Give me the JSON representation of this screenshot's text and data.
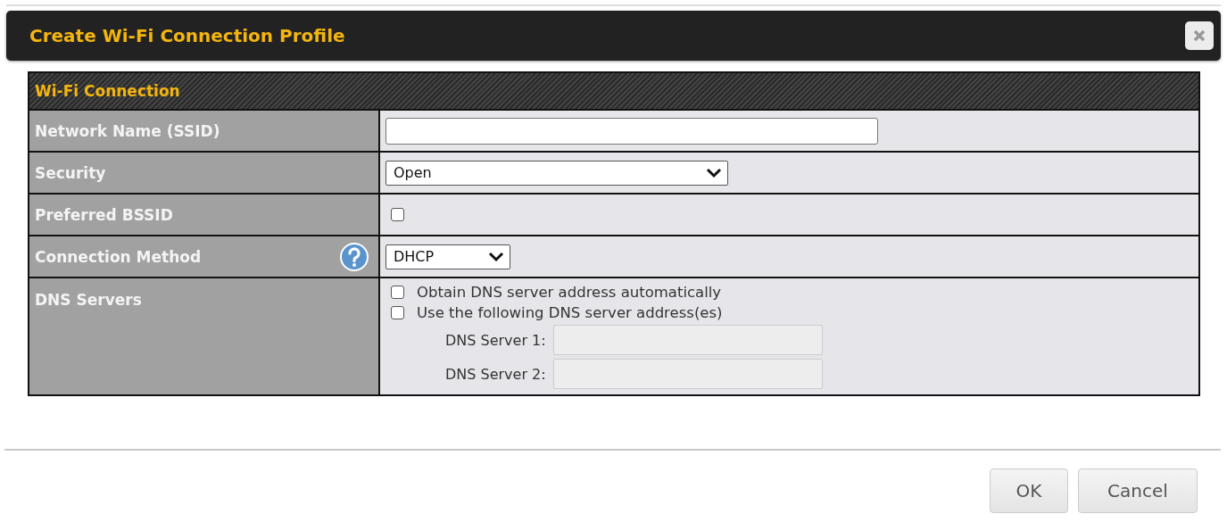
{
  "dialog": {
    "title": "Create Wi-Fi Connection Profile"
  },
  "section": {
    "title": "Wi-Fi Connection"
  },
  "rows": [
    {
      "kind": "text",
      "label": "Network Name (SSID)",
      "value": ""
    },
    {
      "kind": "select",
      "label": "Security",
      "value": "Open",
      "wide": true
    },
    {
      "kind": "checkbox",
      "label": "Preferred BSSID",
      "checked": false
    },
    {
      "kind": "select",
      "label": "Connection Method",
      "value": "DHCP",
      "help": true,
      "wide": false
    },
    {
      "kind": "dns",
      "label": "DNS Servers",
      "options": [
        {
          "label": "Obtain DNS server address automatically",
          "checked": false
        },
        {
          "label": "Use the following DNS server address(es)",
          "checked": false
        }
      ],
      "servers": [
        {
          "label": "DNS Server 1:",
          "disabled": true
        },
        {
          "label": "DNS Server 2:",
          "disabled": true
        }
      ]
    }
  ],
  "buttons": [
    {
      "label": "OK"
    },
    {
      "label": "Cancel"
    }
  ]
}
